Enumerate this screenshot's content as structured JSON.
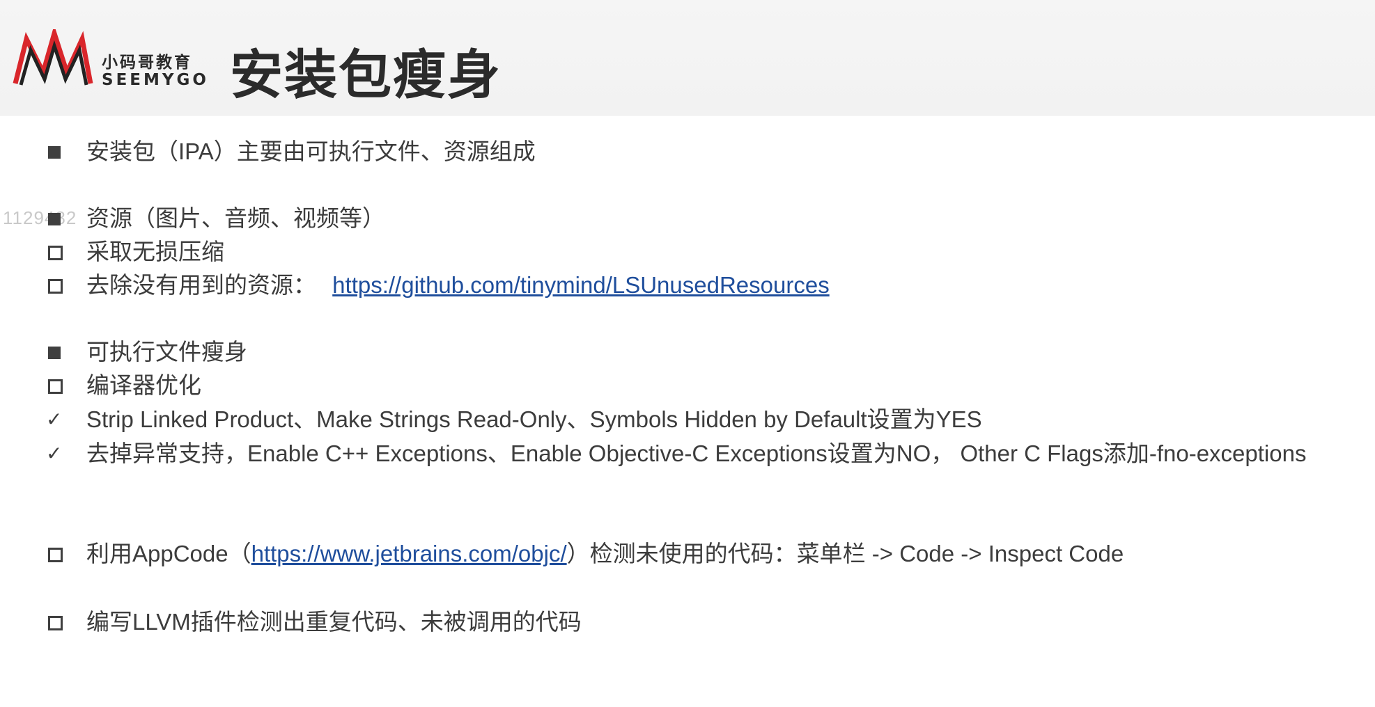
{
  "header": {
    "logo_cn": "小码哥教育",
    "logo_en": "SEEMYGO",
    "title": "安装包瘦身"
  },
  "watermark": "1129482",
  "items": [
    {
      "marker": "filled",
      "text": "安装包（IPA）主要由可执行文件、资源组成"
    },
    {
      "marker": "filled",
      "text": "资源（图片、音频、视频等）"
    },
    {
      "marker": "hollow",
      "text": "采取无损压缩"
    },
    {
      "marker": "hollow",
      "text": "去除没有用到的资源：",
      "link": "https://github.com/tinymind/LSUnusedResources"
    },
    {
      "marker": "filled",
      "text": "可执行文件瘦身"
    },
    {
      "marker": "hollow",
      "text": "编译器优化"
    },
    {
      "marker": "check",
      "text": "Strip Linked Product、Make Strings Read-Only、Symbols Hidden by Default设置为YES"
    },
    {
      "marker": "check",
      "text": "去掉异常支持，Enable C++ Exceptions、Enable Objective-C Exceptions设置为NO， Other C Flags添加-fno-exceptions"
    },
    {
      "marker": "hollow",
      "text_before": "利用AppCode（",
      "link": "https://www.jetbrains.com/objc/",
      "text_after": "）检测未使用的代码：菜单栏 -> Code -> Inspect Code"
    },
    {
      "marker": "hollow",
      "text": "编写LLVM插件检测出重复代码、未被调用的代码"
    }
  ],
  "icons": {
    "filled": "filled-square-bullet-icon",
    "hollow": "hollow-square-bullet-icon",
    "check": "check-mark-icon"
  },
  "colors": {
    "link": "#1f4e9c",
    "logo_red": "#d9262b",
    "text": "#3c3c3c"
  }
}
